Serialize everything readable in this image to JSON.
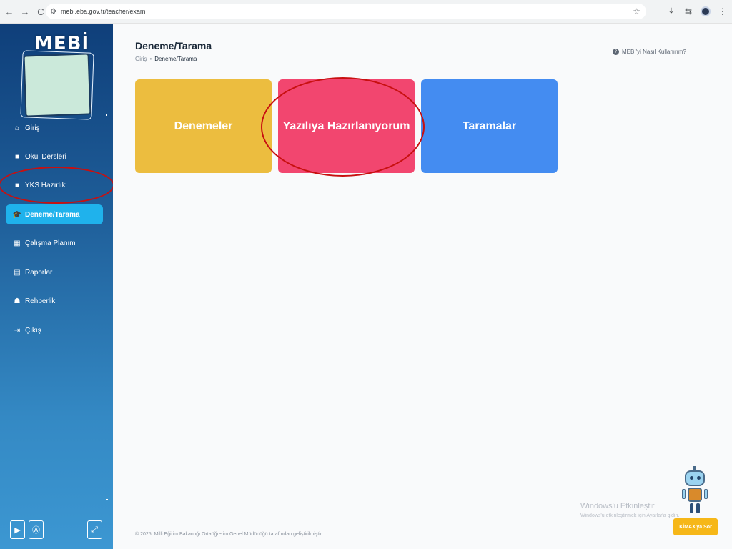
{
  "browser": {
    "url": "mebi.eba.gov.tr/teacher/exam"
  },
  "sidebar": {
    "logo_text": "MEBİ",
    "items": [
      {
        "label": "Giriş",
        "icon": "home-icon"
      },
      {
        "label": "Okul Dersleri",
        "icon": "book-icon"
      },
      {
        "label": "YKS Hazırlık",
        "icon": "book-icon"
      },
      {
        "label": "Deneme/Tarama",
        "icon": "graduation-cap-icon",
        "active": true
      },
      {
        "label": "Çalışma Planım",
        "icon": "calendar-icon"
      },
      {
        "label": "Raporlar",
        "icon": "report-icon"
      },
      {
        "label": "Rehberlik",
        "icon": "people-icon"
      },
      {
        "label": "Çıkış",
        "icon": "logout-icon"
      }
    ]
  },
  "header": {
    "title": "Deneme/Tarama",
    "breadcrumb": [
      "Giriş",
      "Deneme/Tarama"
    ],
    "help_label": "MEBİ'yi Nasıl Kullanırım?"
  },
  "cards": [
    {
      "label": "Denemeler",
      "color": "#ecbd3f"
    },
    {
      "label": "Yazılıya Hazırlanıyorum",
      "color": "#f2466f"
    },
    {
      "label": "Taramalar",
      "color": "#448cf1"
    }
  ],
  "footer": {
    "text": "© 2025, Milli Eğitim Bakanlığı Ortaöğretim Genel Müdürlüğü tarafından geliştirilmiştir."
  },
  "windows_overlay": {
    "title": "Windows'u Etkinleştir",
    "subtitle": "Windows'u etkinleştirmek için Ayarlar'a gidin."
  },
  "assistant": {
    "button_label": "KİMAX'ya Sor"
  },
  "colors": {
    "active_menu": "#1fb2ec",
    "highlight": "#c81010"
  }
}
